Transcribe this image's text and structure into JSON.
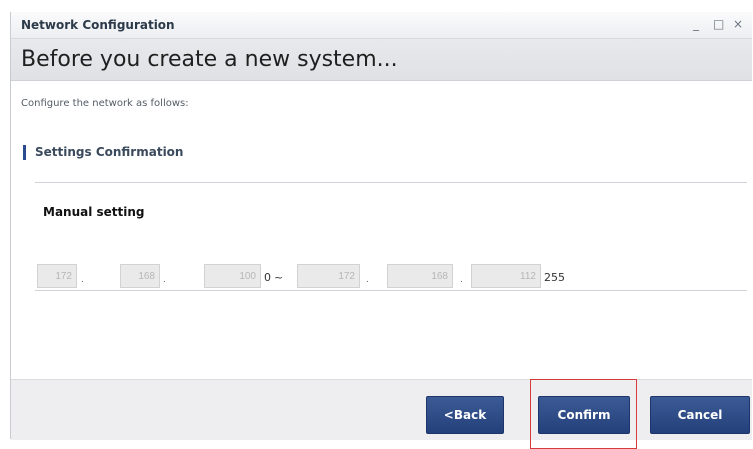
{
  "window": {
    "title": "Network Configuration",
    "controls": {
      "minimize": "_",
      "maximize": "□",
      "close": "×"
    }
  },
  "header": {
    "title": "Before you create a new system..."
  },
  "instruction": "Configure the network as follows:",
  "section": {
    "title": "Settings Confirmation"
  },
  "manual": {
    "label": "Manual setting",
    "start_octets": [
      "172",
      "168",
      "100"
    ],
    "start_last": "0",
    "range_sep": "~",
    "end_octets": [
      "172",
      "168",
      "112"
    ],
    "end_last": "255"
  },
  "buttons": {
    "back": "<Back",
    "confirm": "Confirm",
    "cancel": "Cancel"
  },
  "colors": {
    "button": "#2d4a85",
    "highlight": "#d63a3a",
    "section_bar": "#2a4b8d"
  }
}
